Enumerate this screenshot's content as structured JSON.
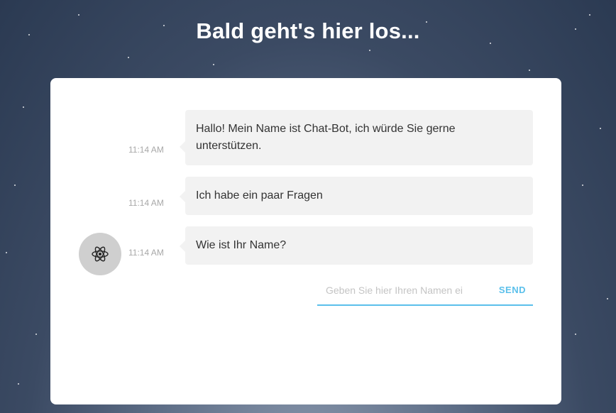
{
  "page": {
    "title": "Bald geht's hier los..."
  },
  "chat": {
    "messages": [
      {
        "time": "11:14 AM",
        "text": "Hallo! Mein Name ist Chat-Bot, ich würde Sie gerne unterstützen."
      },
      {
        "time": "11:14 AM",
        "text": "Ich habe ein paar Fragen"
      },
      {
        "time": "11:14 AM",
        "text": "Wie ist Ihr Name?"
      }
    ],
    "avatar_icon": "atom-icon",
    "input": {
      "placeholder": "Geben Sie hier Ihren Namen ei",
      "value": ""
    },
    "send_label": "SEND"
  },
  "colors": {
    "accent": "#5bc0eb",
    "bubble": "#f2f2f2",
    "timestamp": "#a8a8a8",
    "avatar_bg": "#cfcfcf"
  }
}
